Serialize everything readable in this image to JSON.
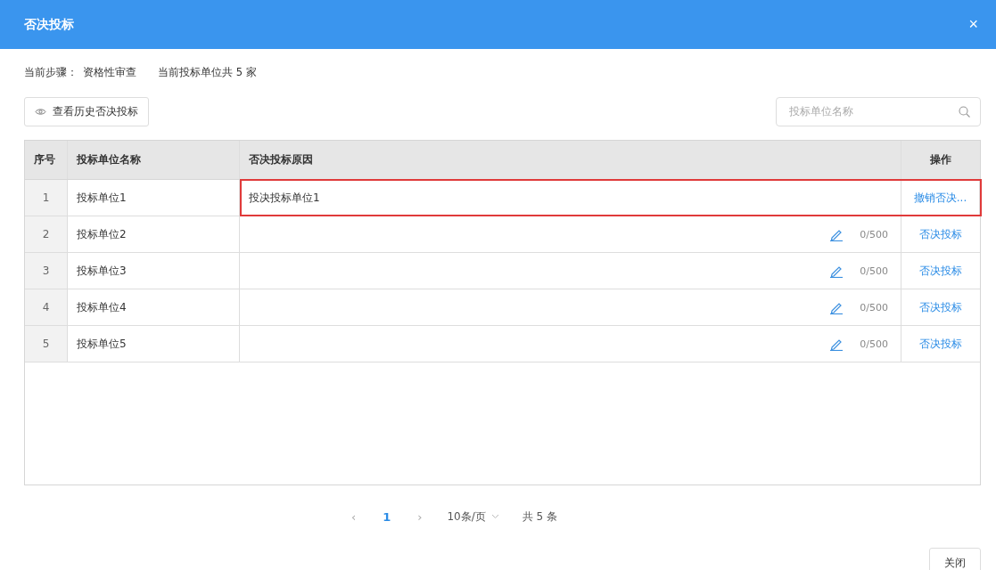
{
  "dialog": {
    "title": "否决投标",
    "close_glyph": "×"
  },
  "info": {
    "step_label": "当前步骤：",
    "step_value": "资格性审查",
    "count_text": "当前投标单位共 5 家"
  },
  "history_button": {
    "label": "查看历史否决投标"
  },
  "search": {
    "placeholder": "投标单位名称"
  },
  "table": {
    "columns": [
      "序号",
      "投标单位名称",
      "否决投标原因",
      "操作"
    ],
    "rows": [
      {
        "index": "1",
        "name": "投标单位1",
        "kind": "rejected",
        "reason": "投决投标单位1",
        "action": "撤销否决...",
        "highlighted": true
      },
      {
        "index": "2",
        "name": "投标单位2",
        "kind": "pending",
        "counter": "0/500",
        "action": "否决投标",
        "highlighted": false
      },
      {
        "index": "3",
        "name": "投标单位3",
        "kind": "pending",
        "counter": "0/500",
        "action": "否决投标",
        "highlighted": false
      },
      {
        "index": "4",
        "name": "投标单位4",
        "kind": "pending",
        "counter": "0/500",
        "action": "否决投标",
        "highlighted": false
      },
      {
        "index": "5",
        "name": "投标单位5",
        "kind": "pending",
        "counter": "0/500",
        "action": "否决投标",
        "highlighted": false
      }
    ]
  },
  "pagination": {
    "prev": "‹",
    "pages": [
      {
        "label": "1",
        "selected": true
      }
    ],
    "next": "›",
    "page_size": "10条/页",
    "total": "共 5 条"
  },
  "footer": {
    "close_button": "关闭"
  }
}
